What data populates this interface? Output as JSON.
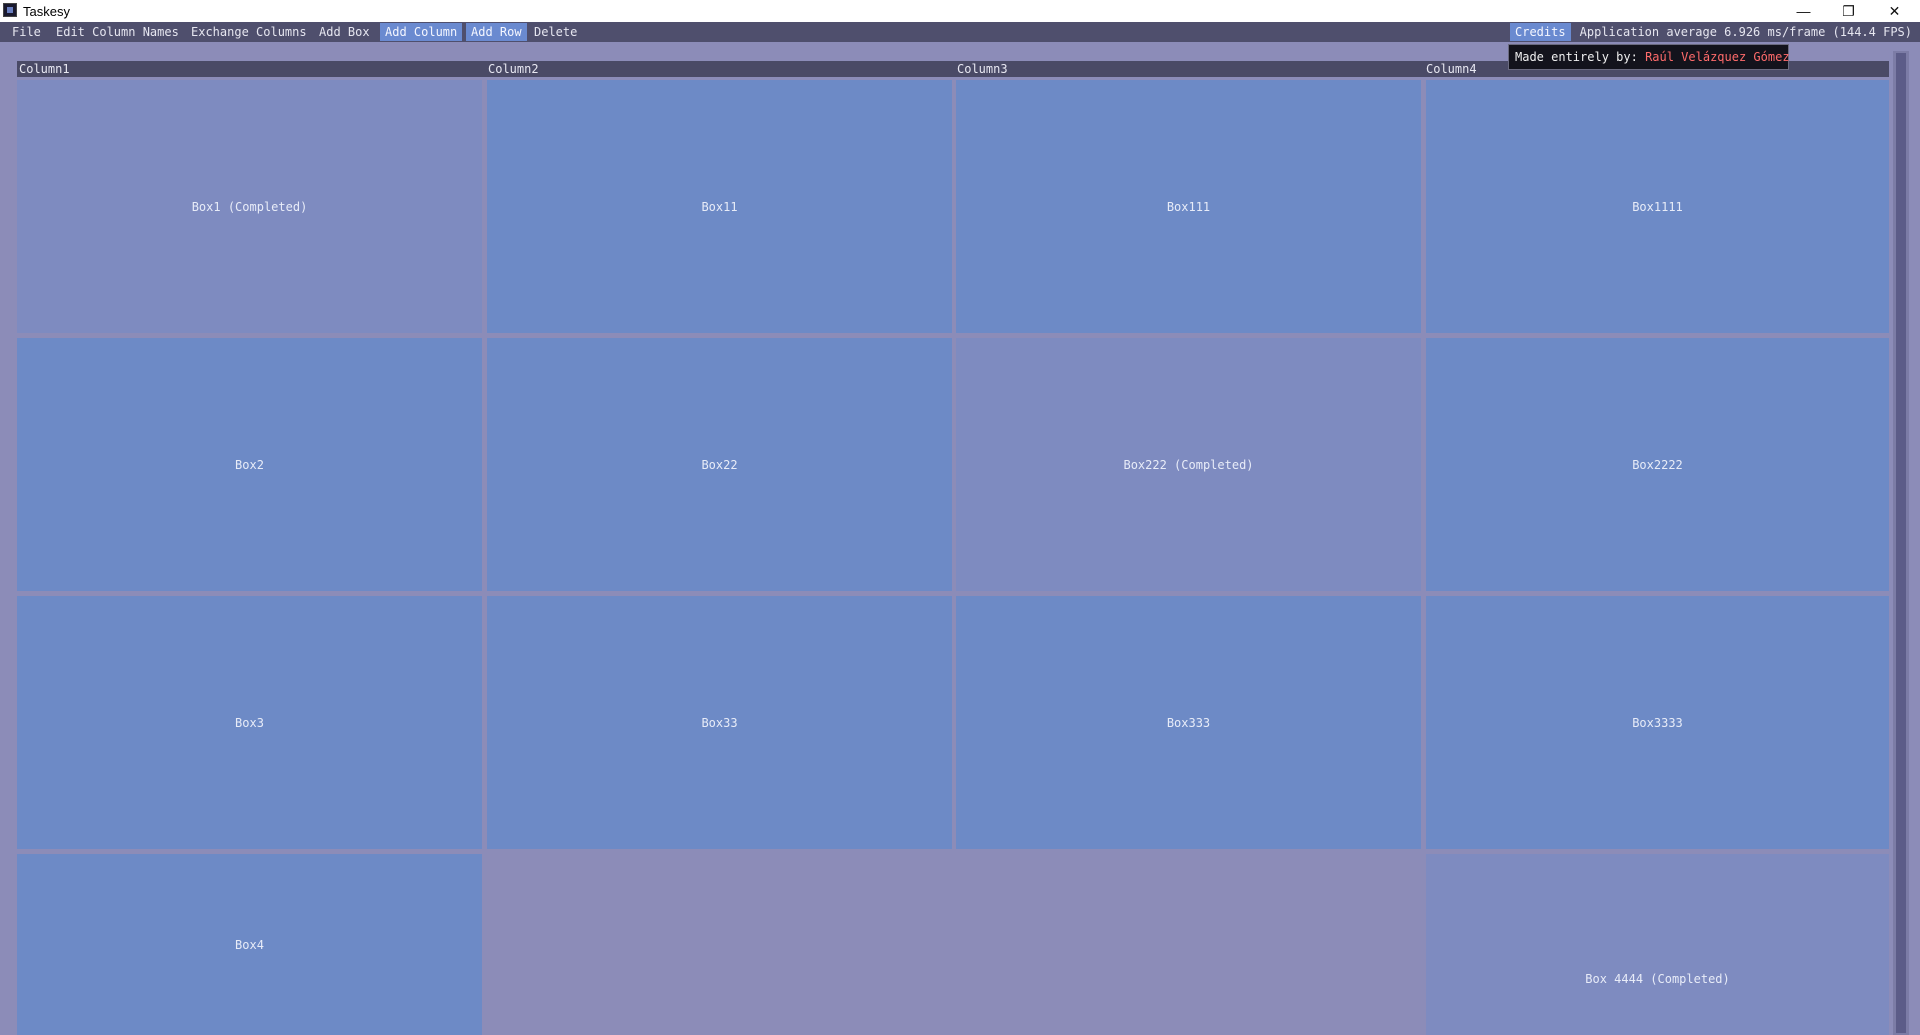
{
  "window": {
    "title": "Taskesy",
    "minimize_glyph": "—",
    "restore_glyph": "❐",
    "close_glyph": "✕"
  },
  "menubar": {
    "items": [
      {
        "label": "File"
      },
      {
        "label": "Edit Column Names"
      },
      {
        "label": "Exchange Columns"
      },
      {
        "label": "Add Box"
      },
      {
        "label": "Add Column"
      },
      {
        "label": "Add Row"
      },
      {
        "label": "Delete"
      }
    ],
    "credits": "Credits",
    "fps_text": "Application average 6.926 ms/frame (144.4 FPS)"
  },
  "tooltip": {
    "prefix": "Made entirely by:",
    "author": "Raúl Velázquez Gómez"
  },
  "columns": [
    {
      "name": "Column1"
    },
    {
      "name": "Column2"
    },
    {
      "name": "Column3"
    },
    {
      "name": "Column4"
    }
  ],
  "boxes": {
    "r1c1": "Box1 (Completed)",
    "r1c2": "Box11",
    "r1c3": "Box111",
    "r1c4": "Box1111",
    "r2c1": "Box2",
    "r2c2": "Box22",
    "r2c3": "Box222 (Completed)",
    "r2c4": "Box2222",
    "r3c1": "Box3",
    "r3c2": "Box33",
    "r3c3": "Box333",
    "r3c4": "Box3333",
    "r4c1": "Box4",
    "r4c4": "Box 4444 (Completed)"
  },
  "colors": {
    "open_box": "#6d8ac6",
    "completed_box": "#7e8bc0",
    "background": "#8c8cb8",
    "menubar": "#4f4f6d",
    "active_menu": "#6a8ad0",
    "author_text": "#ff6b6b"
  }
}
